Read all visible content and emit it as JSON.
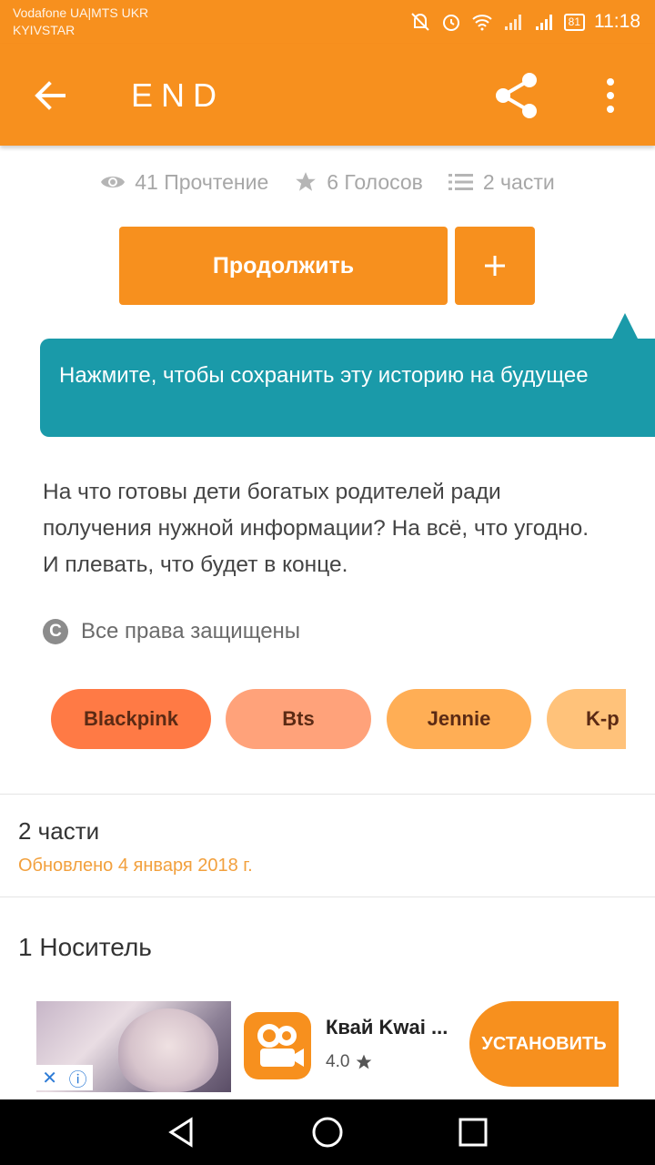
{
  "status_bar": {
    "carrier_line1": "Vodafone UA|MTS UKR",
    "carrier_line2": "KYIVSTAR",
    "battery": "81",
    "time": "11:18"
  },
  "app_bar": {
    "title": "END",
    "icons": [
      "back-arrow",
      "share",
      "more-vertical"
    ]
  },
  "stats": {
    "reads": "41 Прочтение",
    "votes": "6 Голосов",
    "parts": "2 части"
  },
  "actions": {
    "continue_label": "Продолжить",
    "add_label": "+"
  },
  "tooltip": {
    "text": "Нажмите, чтобы сохранить эту историю на будущее"
  },
  "description": "На что готовы дети богатых родителей ради получения нужной информации? На всё, что угодно. И плевать, что будет в конце.",
  "copyright": {
    "icon_letter": "C",
    "text": "Все права защищены"
  },
  "tags": [
    {
      "label": "Blackpink",
      "color": "#ff7a45"
    },
    {
      "label": "Bts",
      "color": "#ffa27a"
    },
    {
      "label": "Jennie",
      "color": "#ffae55"
    },
    {
      "label": "K-p",
      "color": "#ffc27a"
    }
  ],
  "parts_section": {
    "title": "2 части",
    "updated": "Обновлено 4 января 2018 г."
  },
  "carrier_item": "1 Носитель",
  "ad": {
    "app_name": "Квай Kwai ...",
    "rating": "4.0",
    "install_label": "УСТАНОВИТЬ"
  },
  "colors": {
    "accent": "#f7901e",
    "tooltip": "#1a9aa9",
    "updated_text": "#f2a03d"
  }
}
